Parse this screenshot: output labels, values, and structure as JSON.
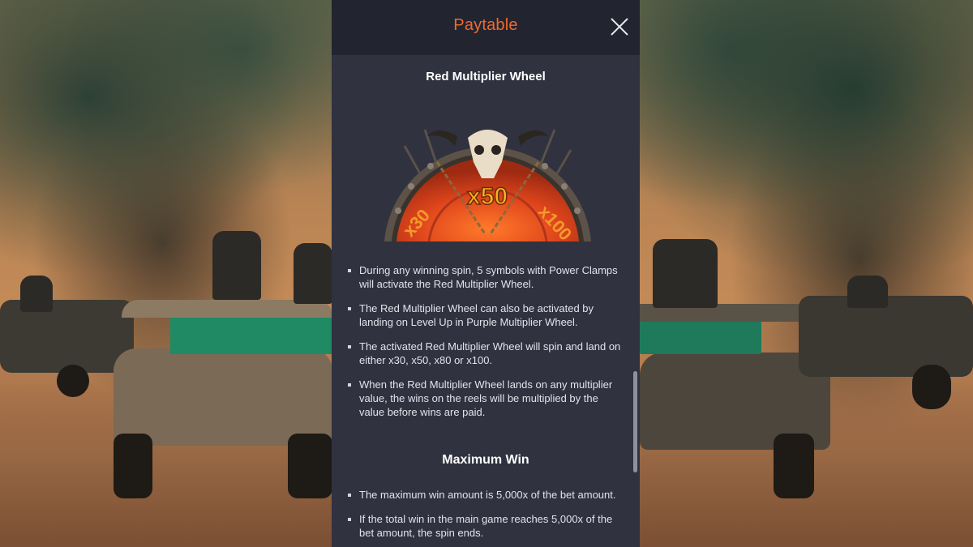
{
  "panel": {
    "title": "Paytable",
    "title_color": "#f06a2c",
    "close_icon": "close-icon"
  },
  "wheel_section": {
    "title": "Red Multiplier Wheel",
    "wheel_labels": [
      "x30",
      "x50",
      "x100"
    ],
    "rules": [
      "During any winning spin, 5 symbols with Power Clamps will activate the Red Multiplier Wheel.",
      "The Red Multiplier Wheel can also be activated by landing on Level Up in Purple Multiplier Wheel.",
      "The activated Red Multiplier Wheel will spin and land on either x30, x50, x80 or x100.",
      "When the Red Multiplier Wheel lands on any multiplier value, the wins on the reels will be multiplied by the value before wins are paid."
    ]
  },
  "max_win_section": {
    "title": "Maximum Win",
    "rules": [
      "The maximum win amount is 5,000x of the bet amount.",
      "If the total win in the main game reaches 5,000x of the bet amount, the spin ends."
    ]
  },
  "colors": {
    "panel_bg": "#303240",
    "header_bg": "#222430",
    "accent": "#f06a2c",
    "wheel_red": "#d9401c",
    "wheel_gold": "#f5b51e"
  }
}
